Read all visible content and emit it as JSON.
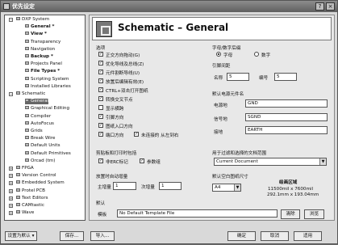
{
  "window": {
    "title": "优先设定",
    "minimize_label": "?",
    "close_label": "×"
  },
  "tree": {
    "nodes": [
      {
        "label": "DXP System",
        "exp": "−",
        "bold": false
      },
      {
        "label": "General *",
        "exp": "",
        "bold": true
      },
      {
        "label": "View *",
        "exp": "",
        "bold": true
      },
      {
        "label": "Transparency",
        "exp": "",
        "bold": false
      },
      {
        "label": "Navigation",
        "exp": "",
        "bold": false
      },
      {
        "label": "Backup *",
        "exp": "",
        "bold": true
      },
      {
        "label": "Projects Panel",
        "exp": "",
        "bold": false
      },
      {
        "label": "File Types *",
        "exp": "",
        "bold": true
      },
      {
        "label": "Scripting System",
        "exp": "",
        "bold": false
      },
      {
        "label": "Installed Libraries",
        "exp": "",
        "bold": false
      },
      {
        "label": "Schematic",
        "exp": "−",
        "bold": false
      },
      {
        "label": "General",
        "exp": "",
        "bold": false
      },
      {
        "label": "Graphical Editing",
        "exp": "",
        "bold": false
      },
      {
        "label": "Compiler",
        "exp": "",
        "bold": false
      },
      {
        "label": "AutoFocus",
        "exp": "",
        "bold": false
      },
      {
        "label": "Grids",
        "exp": "",
        "bold": false
      },
      {
        "label": "Break Wire",
        "exp": "",
        "bold": false
      },
      {
        "label": "Default Units",
        "exp": "",
        "bold": false
      },
      {
        "label": "Default Primitives",
        "exp": "",
        "bold": false
      },
      {
        "label": "Orcad (tm)",
        "exp": "",
        "bold": false
      },
      {
        "label": "FPGA",
        "exp": "+",
        "bold": false
      },
      {
        "label": "Version Control",
        "exp": "+",
        "bold": false
      },
      {
        "label": "Embedded System",
        "exp": "+",
        "bold": false
      },
      {
        "label": "Protel PCB",
        "exp": "+",
        "bold": false
      },
      {
        "label": "Text Editors",
        "exp": "+",
        "bold": false
      },
      {
        "label": "CAMtastic",
        "exp": "+",
        "bold": false
      },
      {
        "label": "Wave",
        "exp": "+",
        "bold": false
      }
    ]
  },
  "header": {
    "title": "Schematic – General"
  },
  "options": {
    "title": "选项",
    "items": [
      {
        "label": "正交方向拖动(G)",
        "checked": true
      },
      {
        "label": "优化导线及总线(Z)",
        "checked": true
      },
      {
        "label": "元件割断导线(U)",
        "checked": true
      },
      {
        "label": "放置后编辑有效(E)",
        "checked": true
      },
      {
        "label": "CTRL+双击打开图纸",
        "checked": true
      },
      {
        "label": "转换交叉节点",
        "checked": true
      },
      {
        "label": "显示横跨",
        "checked": false
      },
      {
        "label": "引脚方向",
        "checked": true
      },
      {
        "label": "图纸入口方向",
        "checked": true
      },
      {
        "label": "端口方向",
        "checked": true
      }
    ],
    "unconnected_label": "未连接的 从左到右",
    "unconnected_checked": true
  },
  "suffix": {
    "title": "字母/数字后缀",
    "options": [
      {
        "label": "字母",
        "selected": true
      },
      {
        "label": "数字",
        "selected": false
      }
    ]
  },
  "pin_margin": {
    "title": "引脚间距",
    "name_label": "名称",
    "name_value": "5",
    "number_label": "编号",
    "number_value": "5"
  },
  "power_ports": {
    "title": "默认电源元件名",
    "rows": [
      {
        "label": "电源地",
        "value": "GND"
      },
      {
        "label": "信号地",
        "value": "SGND"
      },
      {
        "label": "接地",
        "value": "EARTH"
      }
    ]
  },
  "clipboard": {
    "title": "剪贴板和打印时包括",
    "items": [
      {
        "label": "非ERC标记",
        "checked": true
      },
      {
        "label": "参数组",
        "checked": true
      }
    ]
  },
  "filter_scope": {
    "title": "用于过滤和选择的文档范围",
    "value": "Current Document"
  },
  "auto_increment": {
    "title": "放置时自动增量",
    "primary_label": "主增量",
    "primary_value": "1",
    "secondary_label": "次增量",
    "secondary_value": "1"
  },
  "sheet_size": {
    "title": "默认空白图纸尺寸",
    "value": "A4",
    "drawable_label": "绘画区域",
    "dims_mil": "11500mil x 7600mil",
    "dims_mm": "292.1mm x 193.04mm"
  },
  "default": {
    "title": "默认",
    "template_label": "模板",
    "template_value": "No Default Template File",
    "clear_label": "清除",
    "browse_label": "浏览"
  },
  "bottom": {
    "set_default": "设置为默认",
    "save": "保存...",
    "load": "导入...",
    "ok": "确定",
    "cancel": "取消",
    "apply": "适用"
  }
}
